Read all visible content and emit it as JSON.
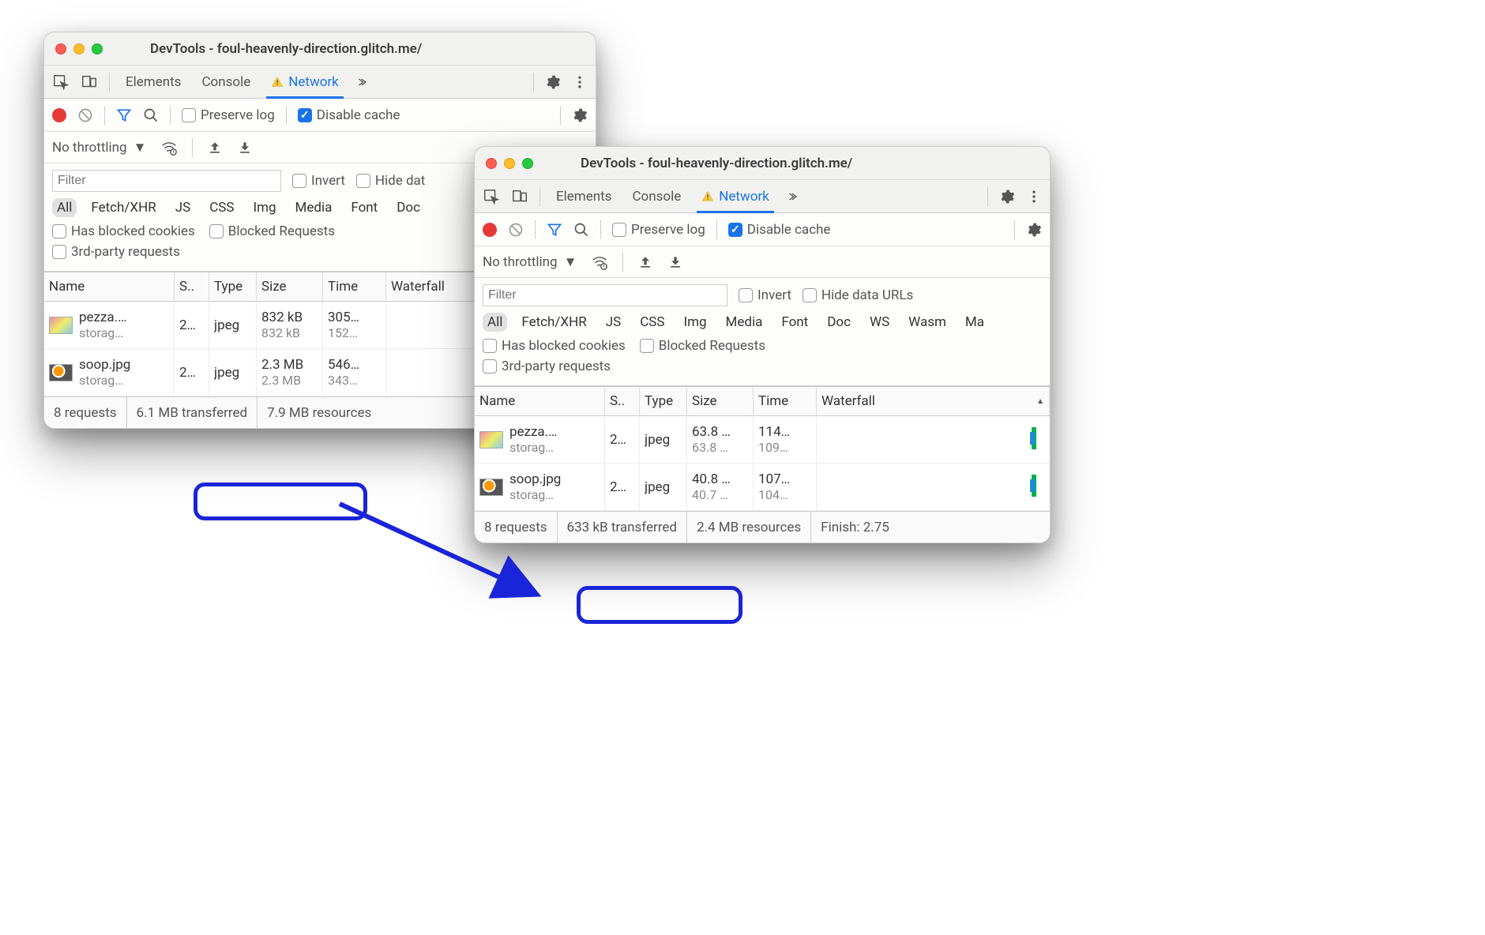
{
  "windows": [
    {
      "title": "DevTools - foul-heavenly-direction.glitch.me/",
      "tabs": [
        "Elements",
        "Console",
        "Network"
      ],
      "active_tab": "Network",
      "toolbar": {
        "preserve_log": "Preserve log",
        "disable_cache": "Disable cache",
        "disable_cache_checked": true
      },
      "throttle": "No throttling",
      "filter_placeholder": "Filter",
      "invert": "Invert",
      "hide_data": "Hide dat",
      "resource_types": [
        "All",
        "Fetch/XHR",
        "JS",
        "CSS",
        "Img",
        "Media",
        "Font",
        "Doc"
      ],
      "active_type": "All",
      "blocked_cookies": "Has blocked cookies",
      "blocked_requests": "Blocked Requests",
      "third_party": "3rd-party requests",
      "columns": [
        "Name",
        "S..",
        "Type",
        "Size",
        "Time",
        "Waterfall"
      ],
      "rows": [
        {
          "name": "pezza.…",
          "domain": "storag…",
          "status": "2…",
          "type": "jpeg",
          "size1": "832 kB",
          "size2": "832 kB",
          "time1": "305…",
          "time2": "152…"
        },
        {
          "name": "soop.jpg",
          "domain": "storag…",
          "status": "2…",
          "type": "jpeg",
          "size1": "2.3 MB",
          "size2": "2.3 MB",
          "time1": "546…",
          "time2": "343…"
        }
      ],
      "status": {
        "requests": "8 requests",
        "transferred": "6.1 MB transferred",
        "resources": "7.9 MB resources"
      }
    },
    {
      "title": "DevTools - foul-heavenly-direction.glitch.me/",
      "tabs": [
        "Elements",
        "Console",
        "Network"
      ],
      "active_tab": "Network",
      "toolbar": {
        "preserve_log": "Preserve log",
        "disable_cache": "Disable cache",
        "disable_cache_checked": true
      },
      "throttle": "No throttling",
      "filter_placeholder": "Filter",
      "invert": "Invert",
      "hide_data": "Hide data URLs",
      "resource_types": [
        "All",
        "Fetch/XHR",
        "JS",
        "CSS",
        "Img",
        "Media",
        "Font",
        "Doc",
        "WS",
        "Wasm",
        "Ma"
      ],
      "active_type": "All",
      "blocked_cookies": "Has blocked cookies",
      "blocked_requests": "Blocked Requests",
      "third_party": "3rd-party requests",
      "columns": [
        "Name",
        "S..",
        "Type",
        "Size",
        "Time",
        "Waterfall"
      ],
      "rows": [
        {
          "name": "pezza.…",
          "domain": "storag…",
          "status": "2…",
          "type": "jpeg",
          "size1": "63.8 …",
          "size2": "63.8 …",
          "time1": "114…",
          "time2": "109…"
        },
        {
          "name": "soop.jpg",
          "domain": "storag…",
          "status": "2…",
          "type": "jpeg",
          "size1": "40.8 …",
          "size2": "40.7 …",
          "time1": "107…",
          "time2": "104…"
        }
      ],
      "status": {
        "requests": "8 requests",
        "transferred": "633 kB transferred",
        "resources": "2.4 MB resources",
        "finish": "Finish: 2.75"
      }
    }
  ]
}
